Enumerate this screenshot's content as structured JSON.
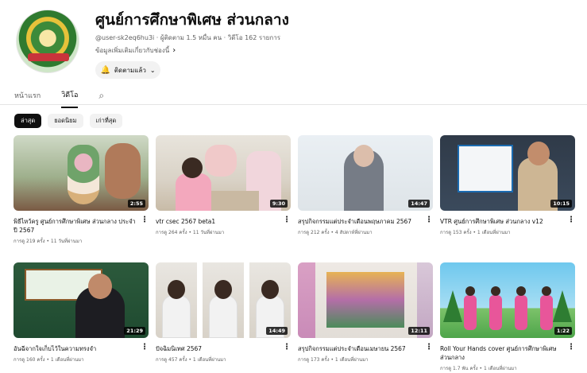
{
  "channel": {
    "name": "ศูนย์การศึกษาพิเศษ ส่วนกลาง",
    "handle": "@user-sk2eq6hu3i",
    "meta": "@user-sk2eq6hu3i · ผู้ติดตาม 1.5 หมื่น คน · วิดีโอ 162 รายการ",
    "more_info": "ข้อมูลเพิ่มเติมเกี่ยวกับช่องนี้",
    "subscribe_label": "ติดตามแล้ว"
  },
  "tabs": [
    {
      "label": "หน้าแรก",
      "active": false
    },
    {
      "label": "วิดีโอ",
      "active": true
    }
  ],
  "chips": [
    {
      "label": "ล่าสุด",
      "active": true
    },
    {
      "label": "ยอดนิยม",
      "active": false
    },
    {
      "label": "เก่าที่สุด",
      "active": false
    }
  ],
  "videos": [
    {
      "title": "พิธีไหว้ครู ศูนย์การศึกษาพิเศษ ส่วนกลาง ประจำปี 2567",
      "meta": "การดู 219 ครั้ง • 11 วันที่ผ่านมา",
      "duration": "2:55"
    },
    {
      "title": "vtr csec 2567 beta1",
      "meta": "การดู 264 ครั้ง • 11 วันที่ผ่านมา",
      "duration": "9:30"
    },
    {
      "title": "สรุปกิจกรรมแต่ประจำเดือนพฤษภาคม 2567",
      "meta": "การดู 212 ครั้ง • 4 สัปดาห์ที่ผ่านมา",
      "duration": "14:47"
    },
    {
      "title": "VTR ศูนย์การศึกษาพิเศษ ส่วนกลาง v12",
      "meta": "การดู 153 ครั้ง • 1 เดือนที่ผ่านมา",
      "duration": "10:15"
    },
    {
      "title": "อันฉีจากใจเก็บไว้ในความทรงจำ",
      "meta": "การดู 160 ครั้ง • 1 เดือนที่ผ่านมา",
      "duration": "21:29"
    },
    {
      "title": "ปัจฉิมนิเทศ 2567",
      "meta": "การดู 457 ครั้ง • 1 เดือนที่ผ่านมา",
      "duration": "14:49"
    },
    {
      "title": "สรุปกิจกรรมแต่ประจำเดือนเมษายน 2567",
      "meta": "การดู 173 ครั้ง • 1 เดือนที่ผ่านมา",
      "duration": "12:11"
    },
    {
      "title": "Roll Your Hands cover ศูนย์การศึกษาพิเศษ ส่วนกลาง",
      "meta": "การดู 1.7 พัน ครั้ง • 1 เดือนที่ผ่านมา",
      "duration": "1:22"
    }
  ]
}
